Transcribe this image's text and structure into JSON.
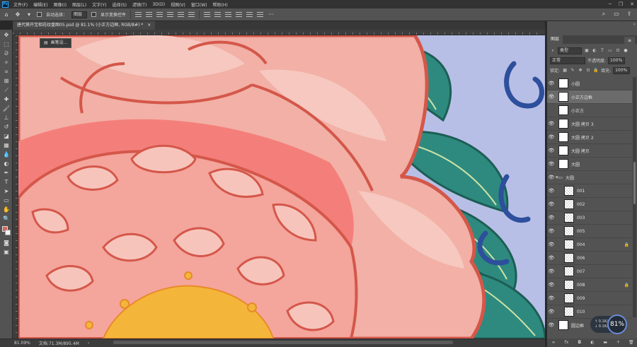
{
  "menubar": {
    "items": [
      "文件(F)",
      "编辑(E)",
      "图像(I)",
      "图层(L)",
      "文字(Y)",
      "选择(S)",
      "滤镜(T)",
      "3D(D)",
      "视图(V)",
      "窗口(W)",
      "帮助(H)"
    ],
    "window_controls": [
      "─",
      "❐",
      "✕"
    ]
  },
  "options": {
    "auto_select_label": "自动选择：",
    "auto_select_value": "图层",
    "show_transform_label": "显示变换控件"
  },
  "document": {
    "tab_title": "唐代葵开宝相花纹盘图05.psd @ 81.1% (小正方边框, RGB/8#) *",
    "tab_close": "×",
    "tooltip": "画笔设..."
  },
  "status": {
    "zoom": "81.09%",
    "doc_size": "文档:71.3M/895.4M",
    "arrow": "›"
  },
  "panel": {
    "collapse": "»",
    "tab_label": "图层",
    "menu": "≡",
    "kind_label": "类型",
    "blend_mode": "正常",
    "opacity_label": "不透明度:",
    "opacity_value": "100%",
    "lock_label": "锁定:",
    "fill_label": "填充:",
    "fill_value": "100%"
  },
  "layers": [
    {
      "name": "小圆",
      "visible": true,
      "active": false,
      "thumb": "white"
    },
    {
      "name": "小正方边框",
      "visible": true,
      "active": true,
      "thumb": "white"
    },
    {
      "name": "小正方",
      "visible": false,
      "active": false,
      "thumb": "white"
    },
    {
      "name": "大圆 拷贝 3",
      "visible": true,
      "active": false,
      "thumb": "white"
    },
    {
      "name": "大圆 拷贝 2",
      "visible": true,
      "active": false,
      "thumb": "white"
    },
    {
      "name": "大圆 拷贝",
      "visible": true,
      "active": false,
      "thumb": "white"
    },
    {
      "name": "大圆",
      "visible": true,
      "active": false,
      "thumb": "white"
    },
    {
      "name": "大圆",
      "visible": true,
      "active": false,
      "thumb": "folder"
    },
    {
      "name": "001",
      "visible": true,
      "active": false,
      "thumb": "checker"
    },
    {
      "name": "002",
      "visible": true,
      "active": false,
      "thumb": "checker"
    },
    {
      "name": "003",
      "visible": true,
      "active": false,
      "thumb": "checker"
    },
    {
      "name": "005",
      "visible": true,
      "active": false,
      "thumb": "checker"
    },
    {
      "name": "004",
      "visible": true,
      "active": false,
      "thumb": "checker",
      "locked": true
    },
    {
      "name": "006",
      "visible": true,
      "active": false,
      "thumb": "checker"
    },
    {
      "name": "007",
      "visible": true,
      "active": false,
      "thumb": "checker"
    },
    {
      "name": "008",
      "visible": true,
      "active": false,
      "thumb": "checker",
      "locked": true
    },
    {
      "name": "009",
      "visible": true,
      "active": false,
      "thumb": "checker"
    },
    {
      "name": "010",
      "visible": true,
      "active": false,
      "thumb": "checker"
    },
    {
      "name": "圆边框",
      "visible": true,
      "active": false,
      "thumb": "white"
    }
  ],
  "perf": {
    "up": "0.1",
    "down": "0.1",
    "unit": "K/s",
    "percent": "81"
  },
  "colors": {
    "foreground": "#d1675a",
    "background": "#f4f4f4",
    "petal": "#f2b0a6",
    "petal_outline": "#d4574a",
    "center_pink": "#f47f7a",
    "gold": "#f4b63a",
    "leaf": "#2e8a7e",
    "scroll_blue": "#2d4f9c",
    "bg_lavender": "#b8bfe6"
  }
}
